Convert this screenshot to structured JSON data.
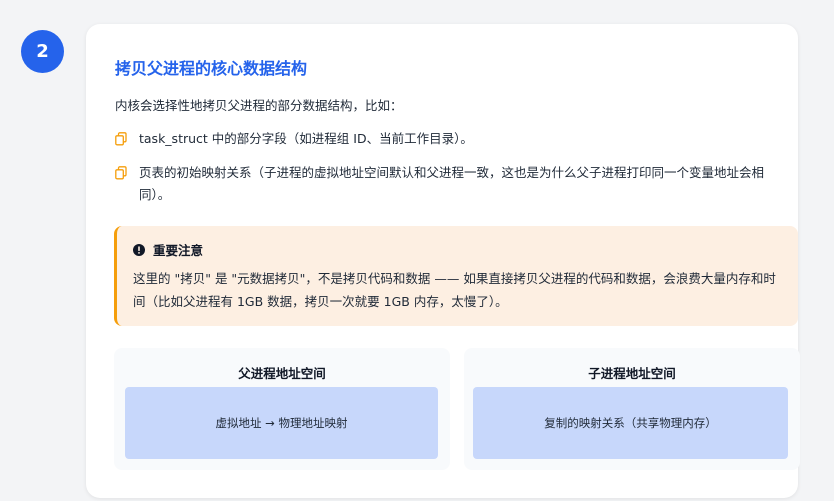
{
  "step": {
    "number": "2"
  },
  "section": {
    "title": "拷贝父进程的核心数据结构",
    "intro": "内核会选择性地拷贝父进程的部分数据结构，比如：",
    "bullets": [
      {
        "icon": "copy-icon",
        "text": "task_struct 中的部分字段（如进程组 ID、当前工作目录）。"
      },
      {
        "icon": "copy-icon",
        "text": "页表的初始映射关系（子进程的虚拟地址空间默认和父进程一致，这也是为什么父子进程打印同一个变量地址会相同）。"
      }
    ]
  },
  "note": {
    "icon": "exclamation-circle-icon",
    "title": "重要注意",
    "body": "这里的 \"拷贝\" 是 \"元数据拷贝\"，不是拷贝代码和数据 —— 如果直接拷贝父进程的代码和数据，会浪费大量内存和时间（比如父进程有 1GB 数据，拷贝一次就要 1GB 内存，太慢了）。"
  },
  "panels": [
    {
      "title": "父进程地址空间",
      "content": "虚拟地址 → 物理地址映射"
    },
    {
      "title": "子进程地址空间",
      "content": "复制的映射关系（共享物理内存）"
    }
  ],
  "colors": {
    "accent": "#2563eb",
    "warning": "#f59e0b",
    "note_bg": "#fdefe2",
    "panel_box": "#c7d7fb"
  }
}
